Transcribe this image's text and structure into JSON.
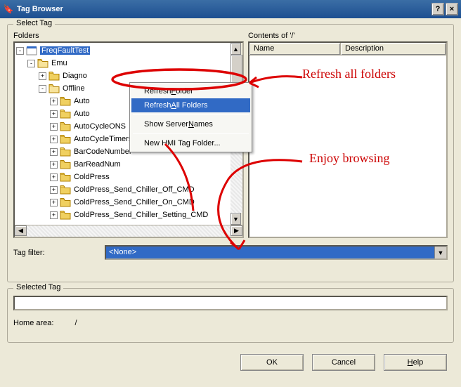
{
  "window": {
    "title": "Tag Browser",
    "help_btn": "?",
    "close_btn": "×"
  },
  "select_tag_group": {
    "legend": "Select Tag",
    "folders_label": "Folders",
    "contents_label": "Contents of '/'",
    "lv_columns": {
      "name": "Name",
      "description": "Description"
    },
    "tree": {
      "root": {
        "label": "FreqFaultTest",
        "expanded": true
      },
      "l1": {
        "label": "Emu",
        "expanded": true
      },
      "l2a": {
        "label": "Diagno"
      },
      "l2b": {
        "label": "Offline",
        "expanded": true
      },
      "items": [
        "Auto",
        "Auto",
        "AutoCycleONS",
        "AutoCycleTimers",
        "BarCodeNumber",
        "BarReadNum",
        "ColdPress",
        "ColdPress_Send_Chiller_Off_CMD",
        "ColdPress_Send_Chiller_On_CMD",
        "ColdPress_Send_Chiller_Setting_CMD"
      ]
    },
    "context_menu": {
      "refresh_folder_pre": "Refresh ",
      "refresh_folder_u": "F",
      "refresh_folder_post": "older",
      "refresh_all_pre": "Refresh ",
      "refresh_all_u": "A",
      "refresh_all_post": "ll Folders",
      "show_server_pre": "Show Server ",
      "show_server_u": "N",
      "show_server_post": "ames",
      "new_hmi": "New HMI Tag Folder..."
    },
    "tag_filter_label": "Tag filter:",
    "tag_filter_value": "<None>"
  },
  "selected_tag_group": {
    "legend": "Selected Tag",
    "value": "",
    "home_area_label": "Home area:",
    "home_area_value": "/"
  },
  "buttons": {
    "ok": "OK",
    "cancel": "Cancel",
    "help_u": "H",
    "help_post": "elp"
  },
  "annotations": {
    "refresh_all": "Refresh all folders",
    "enjoy": "Enjoy browsing"
  }
}
